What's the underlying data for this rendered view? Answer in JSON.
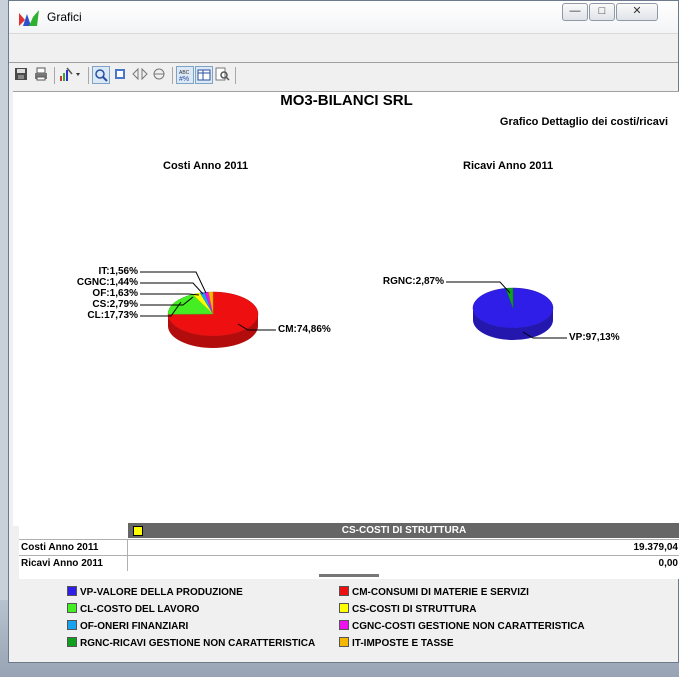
{
  "window": {
    "title": "Grafici"
  },
  "report": {
    "company": "MO3-BILANCI SRL",
    "subtitle": "Grafico Dettaglio dei costi/ricavi"
  },
  "chart_data": [
    {
      "type": "pie",
      "title": "Costi Anno 2011",
      "slices": [
        {
          "code": "CM",
          "value": 74.86,
          "label": "CM:74,86%"
        },
        {
          "code": "CL",
          "value": 17.73,
          "label": "CL:17,73%"
        },
        {
          "code": "CS",
          "value": 2.79,
          "label": "CS:2,79%"
        },
        {
          "code": "OF",
          "value": 1.63,
          "label": "OF:1,63%"
        },
        {
          "code": "CGNC",
          "value": 1.44,
          "label": "CGNC:1,44%"
        },
        {
          "code": "IT",
          "value": 1.56,
          "label": "IT:1,56%"
        }
      ]
    },
    {
      "type": "pie",
      "title": "Ricavi Anno 2011",
      "slices": [
        {
          "code": "VP",
          "value": 97.13,
          "label": "VP:97,13%"
        },
        {
          "code": "RGNC",
          "value": 2.87,
          "label": "RGNC:2,87%"
        }
      ]
    }
  ],
  "colors": {
    "VP": "#2f1ee8",
    "CM": "#ee1010",
    "CL": "#44ee22",
    "CS": "#ffff00",
    "OF": "#19a2ef",
    "CGNC": "#ee10ee",
    "RGNC": "#0ea01e",
    "IT": "#f5b800"
  },
  "grid": {
    "header": "CS-COSTI DI STRUTTURA",
    "rows": [
      {
        "label": "Costi Anno 2011",
        "value": "19.379,04"
      },
      {
        "label": "Ricavi Anno 2011",
        "value": "0,00"
      }
    ]
  },
  "legend": {
    "vp": "VP-VALORE DELLA PRODUZIONE",
    "cm": "CM-CONSUMI DI MATERIE E SERVIZI",
    "cl": "CL-COSTO DEL LAVORO",
    "cs": "CS-COSTI DI STRUTTURA",
    "of": "OF-ONERI FINANZIARI",
    "cgnc": "CGNC-COSTI GESTIONE NON CARATTERISTICA",
    "rgnc": "RGNC-RICAVI GESTIONE NON CARATTERISTICA",
    "it": "IT-IMPOSTE E TASSE"
  },
  "toolbar_icons": [
    "save-icon",
    "print-icon",
    "chart-style-icon",
    "zoom-icon",
    "zoom-fit-icon",
    "rotate-h-icon",
    "rotate-v-icon",
    "labels-icon",
    "data-table-icon",
    "preview-icon"
  ]
}
